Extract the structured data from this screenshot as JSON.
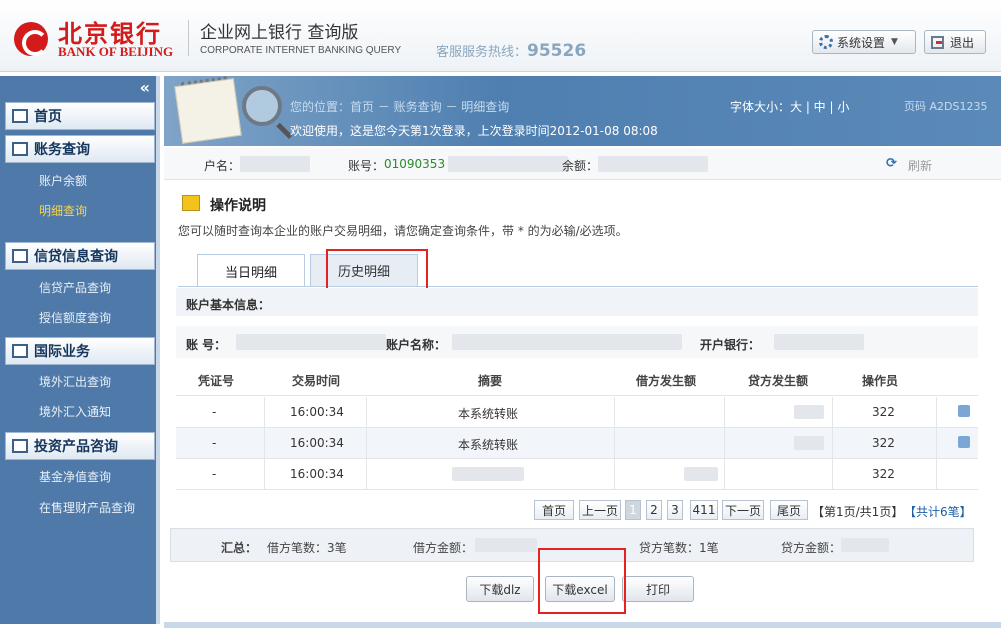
{
  "header": {
    "logo_cn": "北京银行",
    "logo_en": "BANK OF BEIJING",
    "title": "企业网上银行  查询版",
    "subtitle": "CORPORATE INTERNET BANKING QUERY",
    "hotline_label": "客服服务热线：",
    "hotline_number": "95526",
    "settings_label": "系统设置",
    "logout_label": "退出"
  },
  "sidebar": {
    "collapse_glyph": "«",
    "sections": [
      {
        "label": "首页"
      },
      {
        "label": "账务查询"
      },
      {
        "label": "信贷信息查询"
      },
      {
        "label": "国际业务"
      },
      {
        "label": "投资产品咨询"
      }
    ],
    "items": [
      {
        "label": "账户余额"
      },
      {
        "label": "明细查询"
      },
      {
        "label": "信贷产品查询"
      },
      {
        "label": "授信额度查询"
      },
      {
        "label": "境外汇出查询"
      },
      {
        "label": "境外汇入通知"
      },
      {
        "label": "基金净值查询"
      },
      {
        "label": "在售理财产品查询"
      }
    ]
  },
  "banner": {
    "breadcrumb": "您的位置：首页 － 账务查询 － 明细查询",
    "welcome": "欢迎使用，这是您今天第1次登录，上次登录时间2012-01-08 08:08",
    "font_size": "字体大小：大 | 中 | 小",
    "page_code": "页码 A2DS1235"
  },
  "account": {
    "name_label": "户名：",
    "number_label": "账号：",
    "number_prefix": "01090353",
    "balance_label": "余额：",
    "refresh_label": "刷新"
  },
  "instructions": {
    "title": "操作说明",
    "text": "您可以随时查询本企业的账户交易明细，请您确定查询条件，带 * 的为必输/必选项。"
  },
  "tabs": [
    {
      "label": "当日明细"
    },
    {
      "label": "历史明细"
    }
  ],
  "basic_info": {
    "title": "账户基本信息：",
    "account_label": "账  号：",
    "account_name_label": "账户名称：",
    "bank_label": "开户银行："
  },
  "table": {
    "headers": [
      "凭证号",
      "交易时间",
      "摘要",
      "借方发生额",
      "贷方发生额",
      "操作员"
    ],
    "rows": [
      {
        "voucher": "-",
        "time": "16:00:34",
        "summary": "本系统转账",
        "operator": "322"
      },
      {
        "voucher": "-",
        "time": "16:00:34",
        "summary": "本系统转账",
        "operator": "322"
      },
      {
        "voucher": "-",
        "time": "16:00:34",
        "summary": "",
        "operator": "322"
      }
    ]
  },
  "pagination": {
    "first": "首页",
    "prev": "上一页",
    "pages": [
      "1",
      "2",
      "3"
    ],
    "total_count": "411",
    "next": "下一页",
    "last": "尾页",
    "page_info": "【第1页/共1页】",
    "total_info": "【共计6笔】"
  },
  "summary": {
    "label": "汇总：",
    "debit_count": "借方笔数：3笔",
    "debit_amount": "借方金额：",
    "credit_count": "贷方笔数：1笔",
    "credit_amount": "贷方金额："
  },
  "actions": {
    "download_dlz": "下载dlz",
    "download_excel": "下载excel",
    "print": "打印"
  }
}
